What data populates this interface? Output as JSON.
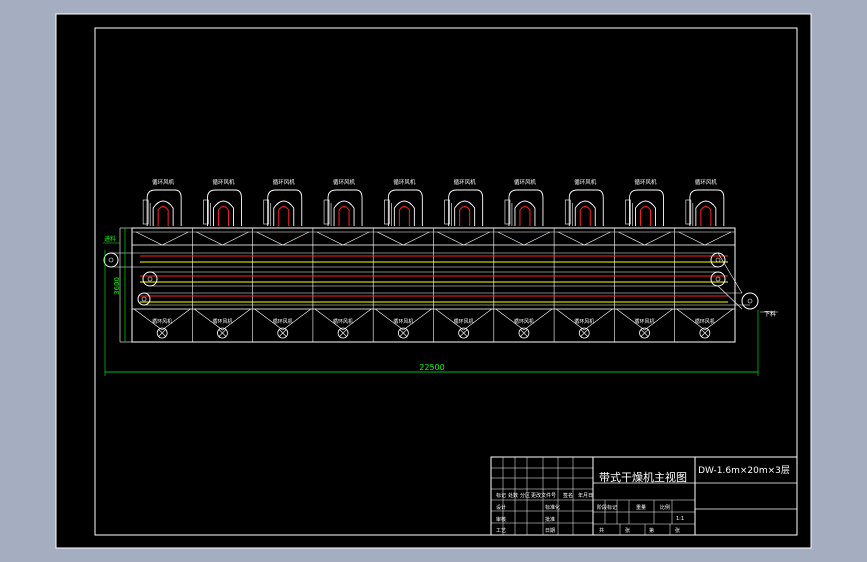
{
  "drawing": {
    "title": "带式干燥机主视图",
    "model": "DW-1.6m×20m×3层",
    "dimensions": {
      "overall_length": "22500",
      "height": "3600"
    },
    "labels": {
      "inlet": "进料",
      "outlet": "下料"
    },
    "fan_label": "循环风机",
    "bottom_fan_label": "循环风机",
    "units": 10
  },
  "title_block": {
    "left_header": [
      "标记",
      "处数",
      "分区",
      "更改文件号",
      "签名",
      "年月日"
    ],
    "left_rows": [
      [
        "设计",
        "",
        "标准化"
      ],
      [
        "审核",
        "",
        "批准"
      ],
      [
        "工艺",
        "",
        "日期"
      ]
    ],
    "mid_header": [
      "阶段标记",
      "重量",
      "比例"
    ],
    "scale": "1:1",
    "footer": [
      "共",
      "张",
      "第",
      "张"
    ]
  },
  "colors": {
    "background": "#a5adc0",
    "sheet": "#000000",
    "line": "#ffffff",
    "accent_green": "#00ff00",
    "accent_red": "#ff2020",
    "accent_yellow": "#ffff00",
    "accent_cyan": "#00ffff"
  }
}
